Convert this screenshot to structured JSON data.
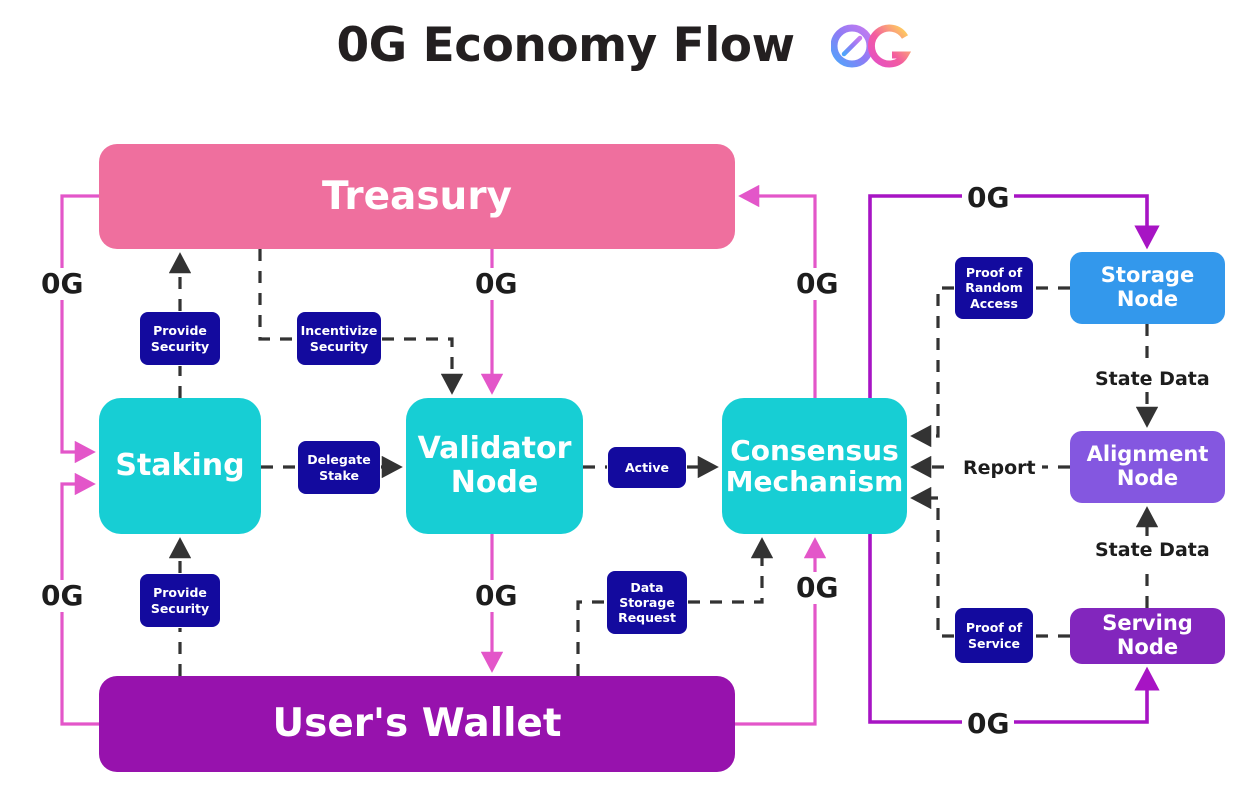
{
  "header": {
    "title": "0G Economy Flow",
    "logo_alt": "0g-logo"
  },
  "palette": {
    "treasury": "#ef6f9e",
    "teal": "#17ced4",
    "wallet": "#9712ad",
    "storage": "#3398ec",
    "alignment": "#8457e0",
    "serving": "#8226bd",
    "chip": "#130a9e",
    "pink_wire": "#e356c9",
    "purple_wire": "#a714c4",
    "dark_wire": "#333333",
    "text": "#1d1d1d"
  },
  "nodes": {
    "treasury": "Treasury",
    "staking": "Staking",
    "validator": "Validator Node",
    "consensus": "Consensus Mechanism",
    "wallet": "User's Wallet",
    "storage": "Storage Node",
    "alignment": "Alignment Node",
    "serving": "Serving Node"
  },
  "chips": {
    "provide_security_top": "Provide Security",
    "incentivize_security": "Incentivize Security",
    "delegate_stake": "Delegate Stake",
    "active": "Active",
    "provide_security_bottom": "Provide Security",
    "data_storage_request": "Data Storage Request",
    "proof_of_random_access": "Proof of Random Access",
    "proof_of_service": "Proof of Service"
  },
  "edge_labels": {
    "token_treasury_to_staking": "0G",
    "token_wallet_to_staking": "0G",
    "token_treasury_to_validator": "0G",
    "token_validator_to_wallet": "0G",
    "token_consensus_to_treasury": "0G",
    "token_wallet_to_consensus": "0G",
    "token_top_right": "0G",
    "token_bottom_right": "0G",
    "state_data_storage": "State Data",
    "state_data_serving": "State Data",
    "report": "Report"
  },
  "chart_data": {
    "type": "diagram",
    "title": "0G Economy Flow",
    "nodes": [
      {
        "id": "treasury",
        "label": "Treasury",
        "color": "#ef6f9e"
      },
      {
        "id": "staking",
        "label": "Staking",
        "color": "#17ced4"
      },
      {
        "id": "validator",
        "label": "Validator Node",
        "color": "#17ced4"
      },
      {
        "id": "consensus",
        "label": "Consensus Mechanism",
        "color": "#17ced4"
      },
      {
        "id": "wallet",
        "label": "User's Wallet",
        "color": "#9712ad"
      },
      {
        "id": "storage",
        "label": "Storage Node",
        "color": "#3398ec"
      },
      {
        "id": "alignment",
        "label": "Alignment Node",
        "color": "#8457e0"
      },
      {
        "id": "serving",
        "label": "Serving Node",
        "color": "#8226bd"
      }
    ],
    "edges": [
      {
        "from": "treasury",
        "to": "staking",
        "label": "0G",
        "style": "solid-pink"
      },
      {
        "from": "wallet",
        "to": "staking",
        "label": "0G",
        "style": "solid-pink"
      },
      {
        "from": "treasury",
        "to": "validator",
        "label": "0G",
        "style": "solid-pink"
      },
      {
        "from": "validator",
        "to": "wallet",
        "label": "0G",
        "style": "solid-pink"
      },
      {
        "from": "consensus",
        "to": "treasury",
        "label": "0G",
        "style": "solid-pink"
      },
      {
        "from": "wallet",
        "to": "consensus",
        "label": "0G",
        "style": "solid-pink"
      },
      {
        "from": "consensus",
        "to": "storage",
        "label": "0G",
        "style": "solid-purple"
      },
      {
        "from": "consensus",
        "to": "serving",
        "label": "0G",
        "style": "solid-purple"
      },
      {
        "from": "staking",
        "to": "treasury",
        "label": "Provide Security",
        "style": "dashed"
      },
      {
        "from": "treasury",
        "to": "validator",
        "label": "Incentivize Security",
        "style": "dashed"
      },
      {
        "from": "staking",
        "to": "validator",
        "label": "Delegate Stake",
        "style": "dashed"
      },
      {
        "from": "validator",
        "to": "consensus",
        "label": "Active",
        "style": "dashed"
      },
      {
        "from": "wallet",
        "to": "staking",
        "label": "Provide Security",
        "style": "dashed"
      },
      {
        "from": "wallet",
        "to": "consensus",
        "label": "Data Storage Request",
        "style": "dashed"
      },
      {
        "from": "storage",
        "to": "consensus",
        "label": "Proof of Random Access",
        "style": "dashed"
      },
      {
        "from": "serving",
        "to": "consensus",
        "label": "Proof of Service",
        "style": "dashed"
      },
      {
        "from": "alignment",
        "to": "consensus",
        "label": "Report",
        "style": "dashed"
      },
      {
        "from": "storage",
        "to": "alignment",
        "label": "State Data",
        "style": "dashed"
      },
      {
        "from": "serving",
        "to": "alignment",
        "label": "State Data",
        "style": "dashed"
      }
    ]
  }
}
